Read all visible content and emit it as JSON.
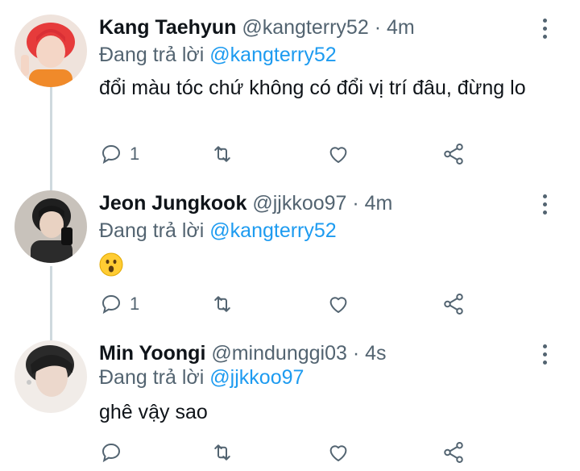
{
  "reply_prefix": "Đang trả lời",
  "tweets": [
    {
      "name": "Kang Taehyun",
      "handle": "@kangterry52",
      "separator": " · ",
      "time": "4m",
      "reply_to": "@kangterry52",
      "text": "đổi màu tóc chứ không có đổi vị trí đâu, đừng lo",
      "reply_count": "1",
      "avatar_color": "#e63b3b"
    },
    {
      "name": "Jeon Jungkook",
      "handle": "@jjkkoo97",
      "separator": " · ",
      "time": "4m",
      "reply_to": "@kangterry52",
      "text": "",
      "emoji": "hushed-face",
      "reply_count": "1",
      "avatar_color": "#2b2b2b"
    },
    {
      "name": "Min Yoongi",
      "handle": "@mindunggi03",
      "separator": " · ",
      "time": "4s",
      "reply_to": "@jjkkoo97",
      "text": "ghê vậy sao",
      "reply_count": "",
      "avatar_color": "#d9c7bf"
    }
  ],
  "icons": {
    "reply": "reply-icon",
    "retweet": "retweet-icon",
    "like": "heart-icon",
    "share": "share-icon",
    "more": "more-vertical-icon"
  },
  "colors": {
    "mention": "#1d9bf0",
    "secondary_text": "#536471",
    "thread_line": "#cfd9de"
  }
}
